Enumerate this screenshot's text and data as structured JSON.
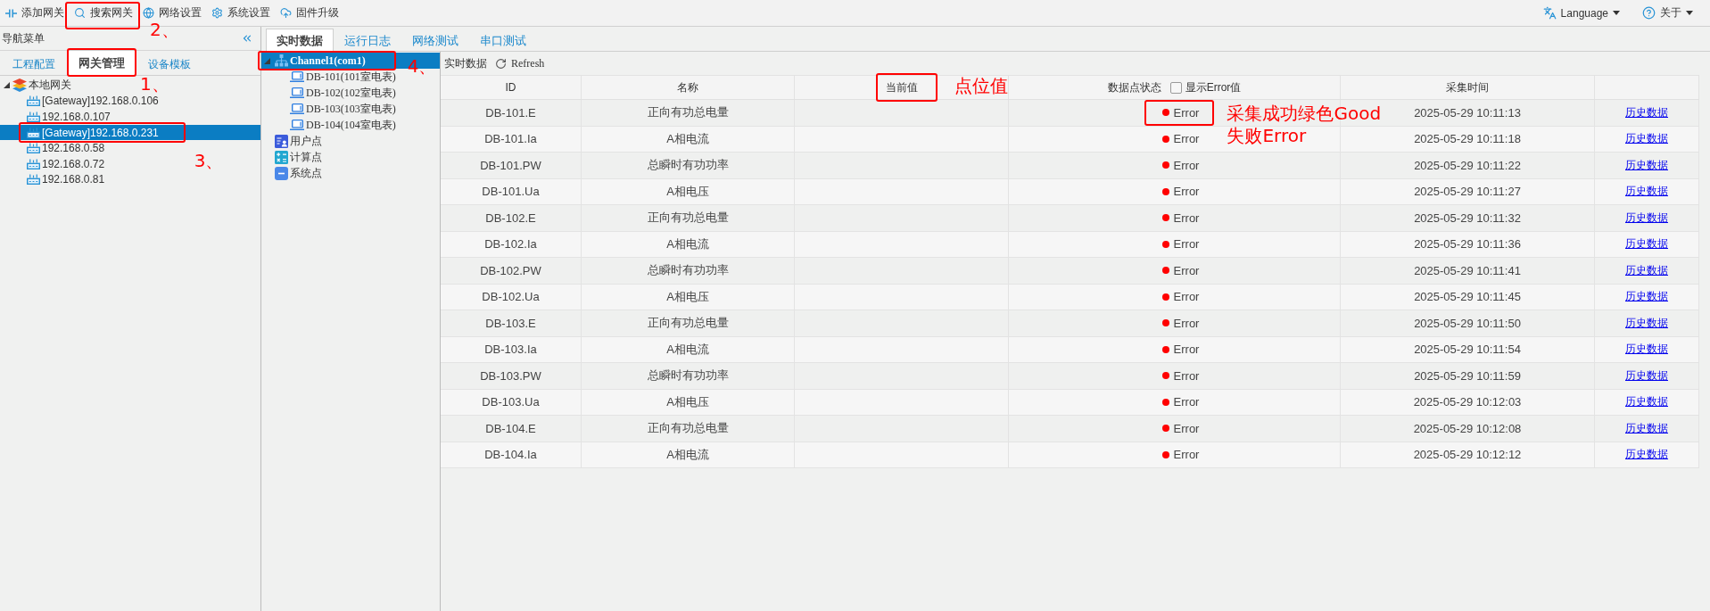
{
  "toolbar": {
    "items": [
      {
        "label": "添加网关"
      },
      {
        "label": "搜索网关",
        "highlighted": true,
        "note": [
          "2、"
        ]
      },
      {
        "label": "网络设置"
      },
      {
        "label": "系统设置"
      },
      {
        "label": "固件升级"
      }
    ],
    "menus": [
      {
        "label": "Language"
      },
      {
        "label": "关于"
      }
    ]
  },
  "nav": {
    "title": "导航菜单",
    "tabs": [
      {
        "label": "工程配置",
        "selected": false
      },
      {
        "label": "网关管理",
        "selected": true,
        "highlighted": true,
        "note": [
          "1、"
        ]
      },
      {
        "label": "设备模板",
        "selected": false
      }
    ],
    "tree": [
      {
        "label": "本地网关",
        "kind": "root",
        "expanded": true,
        "selected": false,
        "children": [
          {
            "label": "[Gateway]192.168.0.106",
            "kind": "gateway",
            "selected": false
          },
          {
            "label": "192.168.0.107",
            "kind": "gateway",
            "selected": false
          },
          {
            "label": "[Gateway]192.168.0.231",
            "kind": "gateway",
            "selected": true,
            "highlighted": true,
            "note": [
              "3、"
            ]
          },
          {
            "label": "192.168.0.58",
            "kind": "gateway",
            "selected": false
          },
          {
            "label": "192.168.0.72",
            "kind": "gateway",
            "selected": false
          },
          {
            "label": "192.168.0.81",
            "kind": "gateway",
            "selected": false
          }
        ]
      }
    ]
  },
  "content": {
    "tabs": [
      {
        "label": "实时数据",
        "selected": true
      },
      {
        "label": "运行日志",
        "selected": false
      },
      {
        "label": "网络测试",
        "selected": false
      },
      {
        "label": "串口测试",
        "selected": false
      }
    ],
    "point_tree": [
      {
        "label": "Channel1(com1)",
        "kind": "channel",
        "expanded": true,
        "selected": true,
        "highlighted": true,
        "note": [
          "4、"
        ],
        "children": [
          {
            "label": "DB-101(101室电表)",
            "kind": "device",
            "selected": false
          },
          {
            "label": "DB-102(102室电表)",
            "kind": "device",
            "selected": false
          },
          {
            "label": "DB-103(103室电表)",
            "kind": "device",
            "selected": false
          },
          {
            "label": "DB-104(104室电表)",
            "kind": "device",
            "selected": false
          }
        ]
      },
      {
        "label": "用户点",
        "kind": "user-points",
        "selected": false
      },
      {
        "label": "计算点",
        "kind": "calc-points",
        "selected": false
      },
      {
        "label": "系统点",
        "kind": "system-points",
        "selected": false
      }
    ],
    "panel": {
      "title": "实时数据",
      "refresh": "Refresh"
    },
    "table": {
      "columns": [
        {
          "label": "ID"
        },
        {
          "label": "名称"
        },
        {
          "label": "当前值",
          "highlighted": true,
          "note": [
            "点位值"
          ]
        },
        {
          "label": "数据点状态",
          "toggle": {
            "label": "显示Error值",
            "checked": false
          }
        },
        {
          "label": "采集时间"
        }
      ],
      "rows": [
        {
          "id": "DB-101.E",
          "name": "正向有功总电量",
          "status": {
            "text": "Error",
            "color": "#ff0000",
            "highlighted": true,
            "note": [
              "采集成功绿色Good",
              "失败Error"
            ]
          },
          "time": "2025-05-29 10:11:13",
          "link": "历史数据"
        },
        {
          "id": "DB-101.Ia",
          "name": "A相电流",
          "status": {
            "text": "Error",
            "color": "#ff0000"
          },
          "time": "2025-05-29 10:11:18",
          "link": "历史数据"
        },
        {
          "id": "DB-101.PW",
          "name": "总瞬时有功功率",
          "status": {
            "text": "Error",
            "color": "#ff0000"
          },
          "time": "2025-05-29 10:11:22",
          "link": "历史数据"
        },
        {
          "id": "DB-101.Ua",
          "name": "A相电压",
          "status": {
            "text": "Error",
            "color": "#ff0000"
          },
          "time": "2025-05-29 10:11:27",
          "link": "历史数据"
        },
        {
          "id": "DB-102.E",
          "name": "正向有功总电量",
          "status": {
            "text": "Error",
            "color": "#ff0000"
          },
          "time": "2025-05-29 10:11:32",
          "link": "历史数据"
        },
        {
          "id": "DB-102.Ia",
          "name": "A相电流",
          "status": {
            "text": "Error",
            "color": "#ff0000"
          },
          "time": "2025-05-29 10:11:36",
          "link": "历史数据"
        },
        {
          "id": "DB-102.PW",
          "name": "总瞬时有功功率",
          "status": {
            "text": "Error",
            "color": "#ff0000"
          },
          "time": "2025-05-29 10:11:41",
          "link": "历史数据"
        },
        {
          "id": "DB-102.Ua",
          "name": "A相电压",
          "status": {
            "text": "Error",
            "color": "#ff0000"
          },
          "time": "2025-05-29 10:11:45",
          "link": "历史数据"
        },
        {
          "id": "DB-103.E",
          "name": "正向有功总电量",
          "status": {
            "text": "Error",
            "color": "#ff0000"
          },
          "time": "2025-05-29 10:11:50",
          "link": "历史数据"
        },
        {
          "id": "DB-103.Ia",
          "name": "A相电流",
          "status": {
            "text": "Error",
            "color": "#ff0000"
          },
          "time": "2025-05-29 10:11:54",
          "link": "历史数据"
        },
        {
          "id": "DB-103.PW",
          "name": "总瞬时有功功率",
          "status": {
            "text": "Error",
            "color": "#ff0000"
          },
          "time": "2025-05-29 10:11:59",
          "link": "历史数据"
        },
        {
          "id": "DB-103.Ua",
          "name": "A相电压",
          "status": {
            "text": "Error",
            "color": "#ff0000"
          },
          "time": "2025-05-29 10:12:03",
          "link": "历史数据"
        },
        {
          "id": "DB-104.E",
          "name": "正向有功总电量",
          "status": {
            "text": "Error",
            "color": "#ff0000"
          },
          "time": "2025-05-29 10:12:08",
          "link": "历史数据"
        },
        {
          "id": "DB-104.Ia",
          "name": "A相电流",
          "status": {
            "text": "Error",
            "color": "#ff0000"
          },
          "time": "2025-05-29 10:12:12",
          "link": "历史数据"
        }
      ]
    }
  }
}
